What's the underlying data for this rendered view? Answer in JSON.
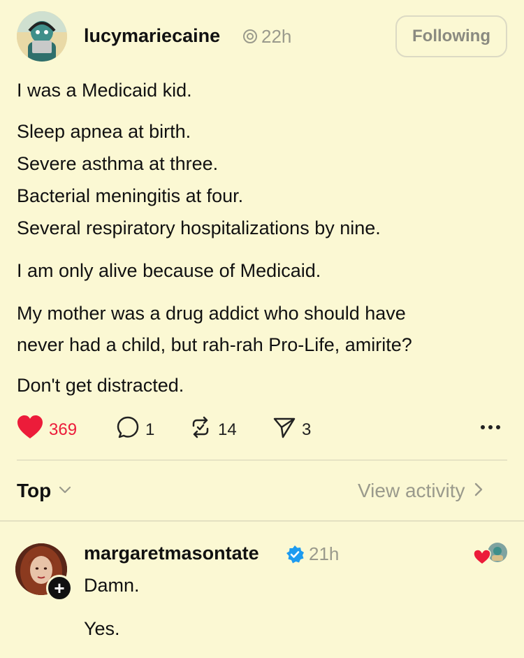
{
  "post": {
    "username": "lucymariecaine",
    "time": "22h",
    "follow_label": "Following",
    "lines": [
      "I was a Medicaid kid.",
      "Sleep apnea at birth.",
      "Severe asthma at three.",
      "Bacterial meningitis at four.",
      "Several respiratory hospitalizations by nine.",
      "I am only alive because of Medicaid.",
      "My mother was a drug addict who should have",
      "never had a child, but rah-rah Pro-Life, amirite?",
      "Don't get distracted."
    ],
    "actions": {
      "likes": "369",
      "comments": "1",
      "reposts": "14",
      "shares": "3"
    }
  },
  "sort": {
    "label": "Top",
    "view_activity": "View activity"
  },
  "reply": {
    "username": "margaretmasontate",
    "time": "21h",
    "lines": [
      "Damn.",
      "Yes."
    ]
  },
  "colors": {
    "background": "#fbf8d3",
    "like_red": "#ec1c3a",
    "verified_blue": "#1d9bf0",
    "muted": "#9a9a8c"
  }
}
